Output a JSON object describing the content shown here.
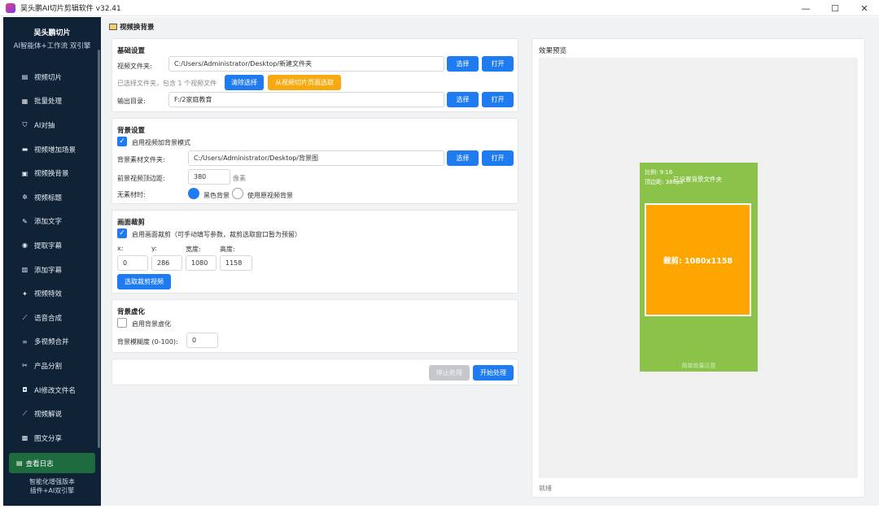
{
  "window": {
    "title": "吴头鹏AI切片剪辑软件 v32.41",
    "minimize": "—",
    "maximize": "☐",
    "close": "✕"
  },
  "sidebar": {
    "brand_name": "吴头鹏切片",
    "brand_sub": "AI智能体+工作流 双引擎",
    "items": [
      {
        "icon": "film-icon",
        "glyph": "▤",
        "label": "视频切片"
      },
      {
        "icon": "stack-icon",
        "glyph": "▦",
        "label": "批量处理"
      },
      {
        "icon": "shield-icon",
        "glyph": "⛉",
        "label": "AI对抽"
      },
      {
        "icon": "layers-icon",
        "glyph": "▬",
        "label": "视频增加场景"
      },
      {
        "icon": "image-icon",
        "glyph": "▣",
        "label": "视频换背景"
      },
      {
        "icon": "sparkle-icon",
        "glyph": "✲",
        "label": "视频标题"
      },
      {
        "icon": "pencil-icon",
        "glyph": "✎",
        "label": "添加文字"
      },
      {
        "icon": "bulb-icon",
        "glyph": "◉",
        "label": "提取字幕"
      },
      {
        "icon": "document-icon",
        "glyph": "▥",
        "label": "添加字幕"
      },
      {
        "icon": "magic-icon",
        "glyph": "✦",
        "label": "视频特效"
      },
      {
        "icon": "mic-icon",
        "glyph": "⟋",
        "label": "语音合成"
      },
      {
        "icon": "link-icon",
        "glyph": "∞",
        "label": "多视频合并"
      },
      {
        "icon": "scissors-icon",
        "glyph": "✂",
        "label": "产品分割"
      },
      {
        "icon": "rename-icon",
        "glyph": "◘",
        "label": "AI修改文件名"
      },
      {
        "icon": "wand-icon",
        "glyph": "⟋",
        "label": "视频解说"
      },
      {
        "icon": "picture-icon",
        "glyph": "▩",
        "label": "图文分享"
      }
    ],
    "log_button": "查看日志",
    "footer_line1": "智能化增强版本",
    "footer_line2": "插件+AI双引擎"
  },
  "page": {
    "title": "视频换背景"
  },
  "basic": {
    "title": "基础设置",
    "video_folder_label": "视频文件夹:",
    "video_folder_value": "C:/Users/Administrator/Desktop/新建文件夹",
    "choose": "选择",
    "open": "打开",
    "selected_info": "已选择文件夹，包含 1 个视频文件",
    "clear": "清除选择",
    "from_page": "从视频切片页面选取",
    "output_label": "输出目录:",
    "output_value": "F:/2家庭教育"
  },
  "background": {
    "title": "背景设置",
    "enable_label": "启用视频加背景模式",
    "enable_checked": true,
    "material_label": "背景素材文件夹:",
    "material_value": "C:/Users/Administrator/Desktop/背景图",
    "choose": "选择",
    "open": "打开",
    "top_margin_label": "前景视频顶边距:",
    "top_margin_value": "380",
    "unit": "像素",
    "no_material_label": "无素材时:",
    "option_black": "黑色背景",
    "option_original": "使用原视频背景",
    "selected_option": "black"
  },
  "crop": {
    "title": "画面裁剪",
    "enable_label": "启用画面裁剪（可手动填写参数，裁剪选取窗口暂为预留）",
    "enable_checked": true,
    "x_label": "x:",
    "y_label": "y:",
    "w_label": "宽度:",
    "h_label": "高度:",
    "x": "0",
    "y": "286",
    "w": "1080",
    "h": "1158",
    "select_button": "选取裁剪视频"
  },
  "blur": {
    "title": "背景虚化",
    "enable_label": "启用背景虚化",
    "enable_checked": false,
    "degree_label": "背景模糊度 (0-100):",
    "degree_value": "0"
  },
  "actions": {
    "stop": "停止处理",
    "start": "开始处理"
  },
  "preview": {
    "title": "效果预览",
    "ratio": "比例: 9:16",
    "margin": "顶边距: 380px",
    "bg_status": "已设置背景文件夹",
    "crop_label": "裁剪: 1080x1158",
    "bottom_note": "简单效果示意",
    "status": "就绪",
    "colors": {
      "background": "#8bc34a",
      "crop": "#ffa500"
    }
  },
  "colors": {
    "primary": "#1e7cf0",
    "orange": "#f7a90f",
    "sidebar_bg": "#0f2236",
    "log_button": "#1d6b3e"
  }
}
